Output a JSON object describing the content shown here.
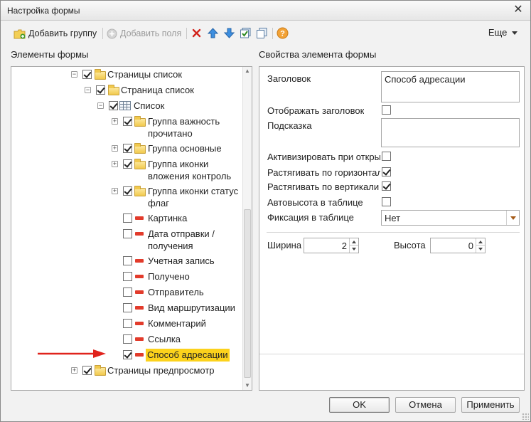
{
  "window": {
    "title": "Настройка формы",
    "close_glyph": "✕"
  },
  "toolbar": {
    "add_group_label": "Добавить группу",
    "add_fields_label": "Добавить поля",
    "more_label": "Еще",
    "icons": [
      "add-group-icon",
      "add-fields-icon",
      "delete-icon",
      "move-up-icon",
      "move-down-icon",
      "check-all-icon",
      "copy-icon",
      "help-icon"
    ]
  },
  "tree": {
    "header": "Элементы формы",
    "items": [
      {
        "label": "Страницы список",
        "level": 0,
        "checked": true,
        "icon": "folder",
        "expander": "⊖"
      },
      {
        "label": "Страница список",
        "level": 1,
        "checked": true,
        "icon": "folder",
        "expander": "⊖"
      },
      {
        "label": "Список",
        "level": 2,
        "checked": true,
        "icon": "table",
        "expander": "⊖"
      },
      {
        "label": "Группа важность прочитано",
        "lines": [
          "Группа важность",
          "прочитано"
        ],
        "level": 3,
        "checked": true,
        "icon": "folder",
        "expander": "⊕"
      },
      {
        "label": "Группа основные",
        "level": 3,
        "checked": true,
        "icon": "folder",
        "expander": "⊕"
      },
      {
        "label": "Группа иконки вложения контроль",
        "lines": [
          "Группа иконки",
          "вложения контроль"
        ],
        "level": 3,
        "checked": true,
        "icon": "folder",
        "expander": "⊕"
      },
      {
        "label": "Группа иконки статус флаг",
        "lines": [
          "Группа иконки статус",
          "флаг"
        ],
        "level": 3,
        "checked": true,
        "icon": "folder",
        "expander": "⊕"
      },
      {
        "label": "Картинка",
        "level": 3,
        "checked": false,
        "icon": "field"
      },
      {
        "label": "Дата отправки / получения",
        "lines": [
          "Дата отправки /",
          "получения"
        ],
        "level": 3,
        "checked": false,
        "icon": "field"
      },
      {
        "label": "Учетная запись",
        "level": 3,
        "checked": false,
        "icon": "field"
      },
      {
        "label": "Получено",
        "level": 3,
        "checked": false,
        "icon": "field"
      },
      {
        "label": "Отправитель",
        "level": 3,
        "checked": false,
        "icon": "field"
      },
      {
        "label": "Вид маршрутизации",
        "level": 3,
        "checked": false,
        "icon": "field"
      },
      {
        "label": "Комментарий",
        "level": 3,
        "checked": false,
        "icon": "field"
      },
      {
        "label": "Ссылка",
        "level": 3,
        "checked": false,
        "icon": "field"
      },
      {
        "label": "Способ адресации",
        "level": 3,
        "checked": true,
        "icon": "field",
        "selected": true
      },
      {
        "label": "Страницы предпросмотр",
        "level": 0,
        "checked": true,
        "icon": "folder",
        "expander": "⊕"
      }
    ]
  },
  "properties": {
    "header": "Свойства элемента формы",
    "title_label": "Заголовок",
    "title_value": "Способ адресации",
    "show_title_label": "Отображать заголовок",
    "show_title_checked": false,
    "hint_label": "Подсказка",
    "hint_value": "",
    "activate_label": "Активизировать при откры",
    "activate_checked": false,
    "stretch_h_label": "Растягивать по горизонтал",
    "stretch_h_checked": true,
    "stretch_v_label": "Растягивать по вертикали",
    "stretch_v_checked": true,
    "autoheight_label": "Автовысота в таблице",
    "autoheight_checked": false,
    "fix_label": "Фиксация в таблице",
    "fix_value": "Нет",
    "width_label": "Ширина",
    "width_value": "2",
    "height_label": "Высота",
    "height_value": "0"
  },
  "buttons": {
    "ok": "OK",
    "cancel": "Отмена",
    "apply": "Применить"
  },
  "colors": {
    "selection": "#fcd21c",
    "arrow": "#e0231c",
    "field_marker": "#e23b2b"
  }
}
